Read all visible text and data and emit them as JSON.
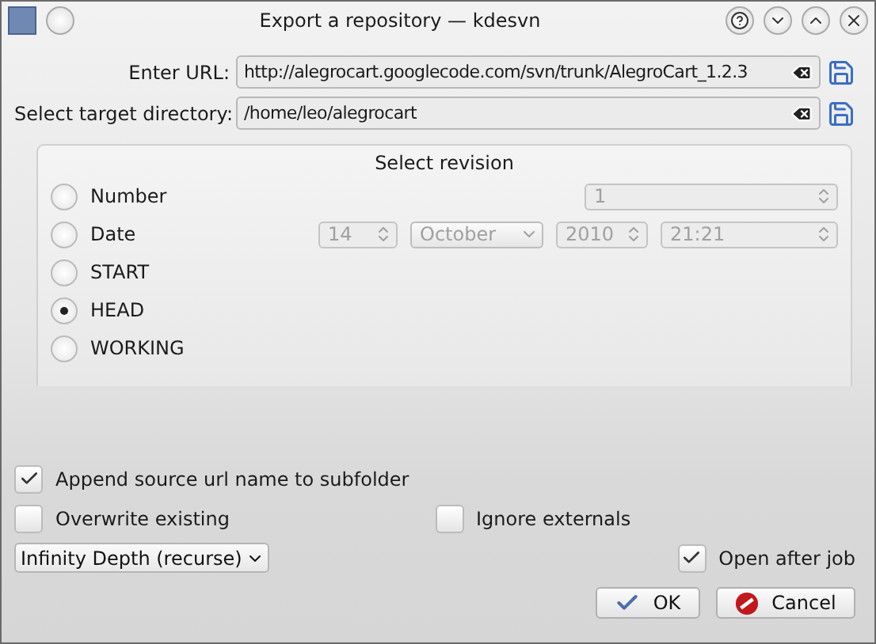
{
  "window": {
    "title": "Export a repository — kdesvn"
  },
  "fields": [
    {
      "label": "Enter URL:",
      "value": "http://alegrocart.googlecode.com/svn/trunk/AlegroCart_1.2.3"
    },
    {
      "label": "Select target directory:",
      "value": "/home/leo/alegrocart"
    }
  ],
  "revision": {
    "title": "Select revision",
    "options": [
      {
        "label": "Number",
        "selected": false,
        "kind": "number"
      },
      {
        "label": "Date",
        "selected": false,
        "kind": "date"
      },
      {
        "label": "START",
        "selected": false,
        "kind": "plain"
      },
      {
        "label": "HEAD",
        "selected": true,
        "kind": "plain"
      },
      {
        "label": "WORKING",
        "selected": false,
        "kind": "plain"
      }
    ],
    "number": {
      "value": "1",
      "disabled": true
    },
    "date": {
      "day": "14",
      "month": "October",
      "year": "2010",
      "time": "21:21",
      "disabled": true
    }
  },
  "append_source": {
    "label": "Append source url name to subfolder",
    "checked": true
  },
  "overwrite": {
    "label": "Overwrite existing",
    "checked": false
  },
  "ignore_externals": {
    "label": "Ignore externals",
    "checked": false
  },
  "depth": {
    "value": "Infinity Depth (recurse)"
  },
  "open_after_job": {
    "label": "Open after job",
    "checked": true
  },
  "buttons": [
    {
      "label": "OK",
      "kind": "ok"
    },
    {
      "label": "Cancel",
      "kind": "cancel"
    }
  ]
}
